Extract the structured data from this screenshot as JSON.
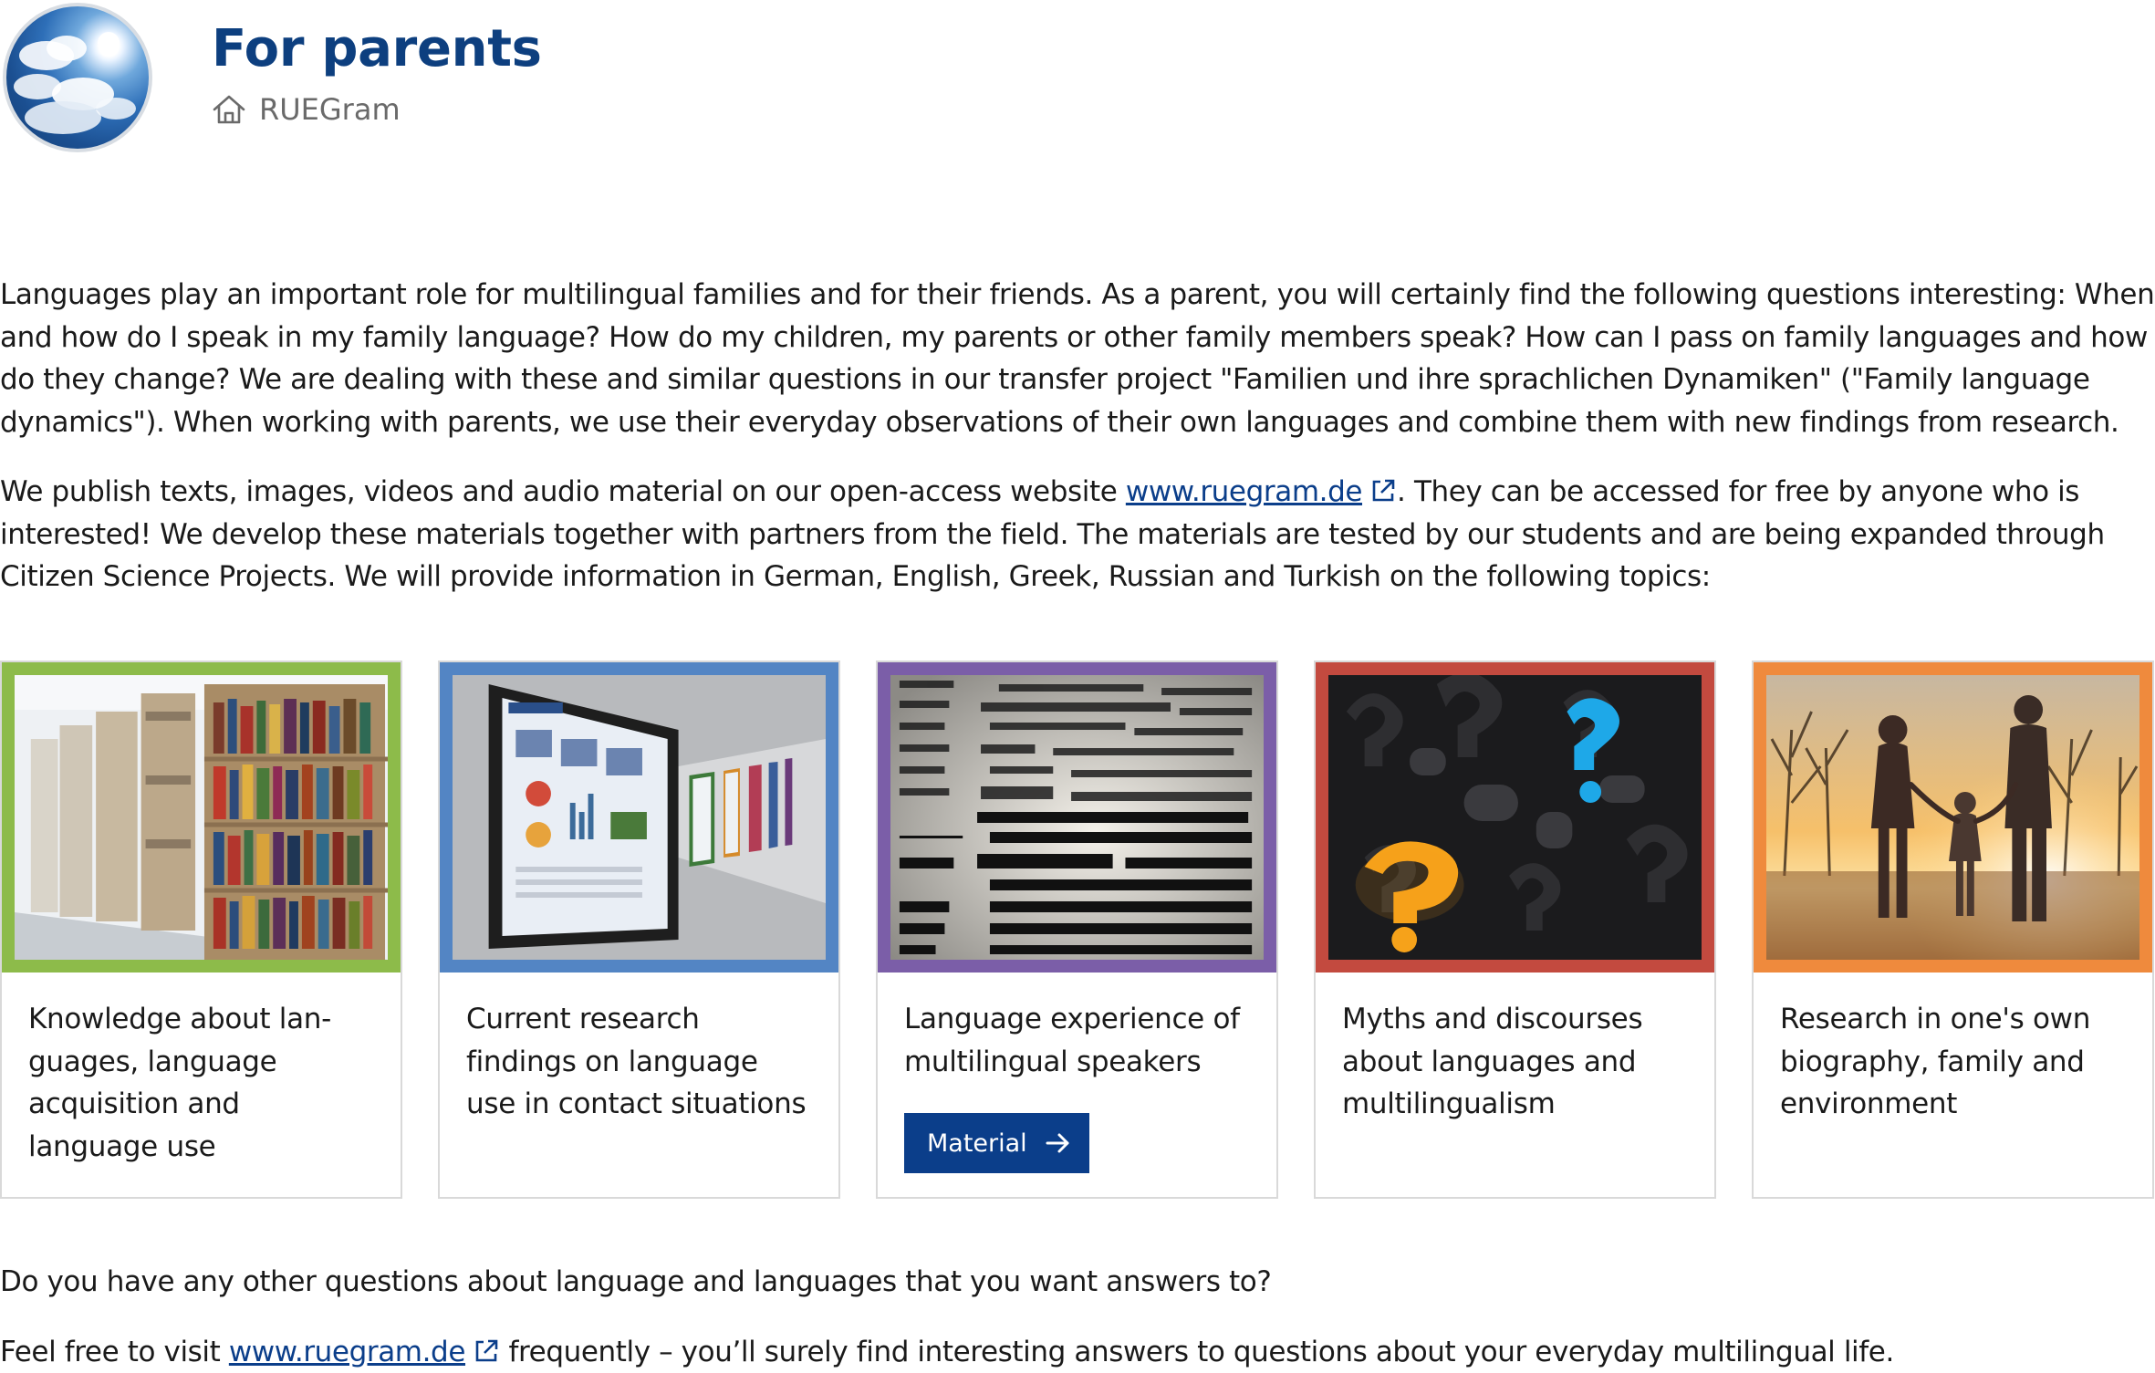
{
  "header": {
    "title": "For parents",
    "breadcrumb": "RUEGram"
  },
  "intro": {
    "paragraph1": "Languages play an important role for multilingual families and for their friends. As a parent, you will certainly find the following questions interesting: When and how do I speak in my family language? How do my children, my parents or other family members speak? How can I pass on family languages and how do they change? We are dealing with these and similar questions in our transfer project \"Familien und ihre sprachlichen Dynamiken\" (\"Family language dynamics\"). When working with parents, we use their everyday observations of their own languages and combine them with new findings from research.",
    "paragraph2_before_link": "We publish texts, images, videos and audio material on our open-access website ",
    "paragraph2_link": "www.ruegram.de",
    "paragraph2_after_link": ". They can be accessed for free by anyone who is interested! We develop these materials together with partners from the field. The materials are tested by our students and are being expanded through Citizen Science Projects. We will provide information in German, English, Greek, Russian and Turkish on the following topics:"
  },
  "cards": [
    {
      "label": "Knowledge about lan­guages, language acquisi­tion and language use",
      "frame_color": "#8dbb4a",
      "icon": "library-bookshelves-image"
    },
    {
      "label": "Current research findings on language use in con­tact situations",
      "frame_color": "#5385c4",
      "icon": "poster-hallway-image"
    },
    {
      "label": "Language experience of multilingual speakers",
      "frame_color": "#7b5ea8",
      "icon": "dictionary-page-image",
      "button": "Material"
    },
    {
      "label": "Myths and discourses about languages and multilingualism",
      "frame_color": "#c34a3f",
      "icon": "question-marks-image"
    },
    {
      "label": "Research in one's own bi­ography, family and environment",
      "frame_color": "#ef8a3d",
      "icon": "family-walking-image"
    }
  ],
  "outro": {
    "question": "Do you have any other questions about language and languages that you want answers to?",
    "visit_before_link": "Feel free to visit ",
    "visit_link": "www.ruegram.de",
    "visit_after_link": " frequently – you’ll surely find interesting answers to questions about your everyday multilingual life."
  }
}
